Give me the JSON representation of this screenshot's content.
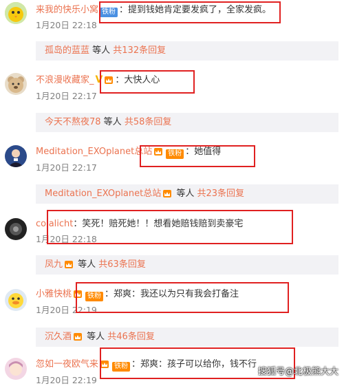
{
  "comments": [
    {
      "username": "来我的快乐小窝",
      "badge": "铁粉",
      "badge_color": "#4a90e2",
      "text": "提到钱她肯定要发疯了，全家发疯。",
      "date": "1月20日 22:18",
      "avatar": "yellow-bird-icon"
    },
    {
      "username": "不浪漫收藏家_",
      "badge": "",
      "text": "大快人心",
      "date": "1月20日 22:17",
      "avatar": "bear-icon"
    },
    {
      "username": "Meditation_EXOplanet总站",
      "badge": "铁粉",
      "badge_color": "#ff8a00",
      "text": "她值得",
      "date": "1月20日 22:17",
      "avatar": "person-icon"
    },
    {
      "username": "colalicht",
      "badge": "",
      "text": "笑死！赔死她！！想看她赔钱赔到卖豪宅",
      "date": "1月20日 22:18",
      "avatar": "dark-icon"
    },
    {
      "username": "小雅快桃",
      "badge": "铁粉",
      "badge_color": "#ff8a00",
      "text": "郑爽：我还以为只有我会打备注",
      "date": "1月20日 22:19",
      "avatar": "duck-icon"
    },
    {
      "username": "忽如一夜欧气来",
      "badge": "铁粉",
      "badge_color": "#ff8a00",
      "text": "郑爽：孩子可以给你，钱不行",
      "date": "1月20日 22:19",
      "avatar": "anime-girl-icon"
    }
  ],
  "replies": [
    {
      "name": "孤岛的蓝蓝",
      "middle": " 等人 ",
      "count": "共132条回复"
    },
    {
      "name": "今天不熬夜78",
      "middle": " 等人 ",
      "count": "共58条回复"
    },
    {
      "name": "Meditation_EXOplanet总站",
      "middle": " 等人 ",
      "count": "共23条回复"
    },
    {
      "name": "凤九",
      "middle": " 等人 ",
      "count": "共63条回复"
    },
    {
      "name": "沉久酒",
      "middle": " 等人 ",
      "count": "共46条回复"
    }
  ],
  "colon": "：",
  "watermark": "搜狐号@北极熊大大",
  "colors": {
    "username": "#eb7350",
    "highlight": "#e02020",
    "reply_bg": "#f2f2f5"
  }
}
